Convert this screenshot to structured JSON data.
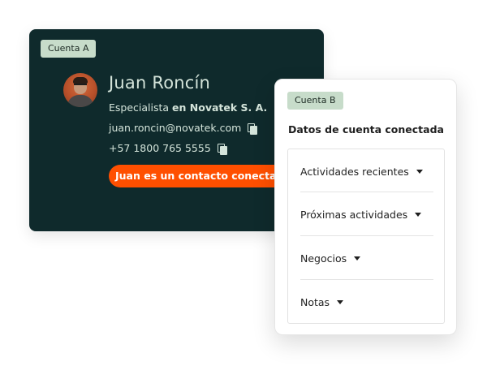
{
  "account_a": {
    "badge": "Cuenta A",
    "name": "Juan Roncín",
    "role_prefix": "Especialista ",
    "role_company": "en Novatek S. A.",
    "email": "juan.roncin@novatek.com",
    "phone": "+57 1800 765 5555",
    "cta_label": "Juan es un contacto conectado"
  },
  "account_b": {
    "badge": "Cuenta B",
    "title": "Datos de cuenta conectada",
    "sections": [
      {
        "label": "Actividades recientes"
      },
      {
        "label": "Próximas actividades"
      },
      {
        "label": "Negocios"
      },
      {
        "label": "Notas"
      }
    ]
  },
  "colors": {
    "card_a_background": "#0f2a2c",
    "badge_background": "#c7dcca",
    "cta_background": "#ff4f00"
  },
  "icons": [
    "copy-icon",
    "chevron-down-icon"
  ]
}
